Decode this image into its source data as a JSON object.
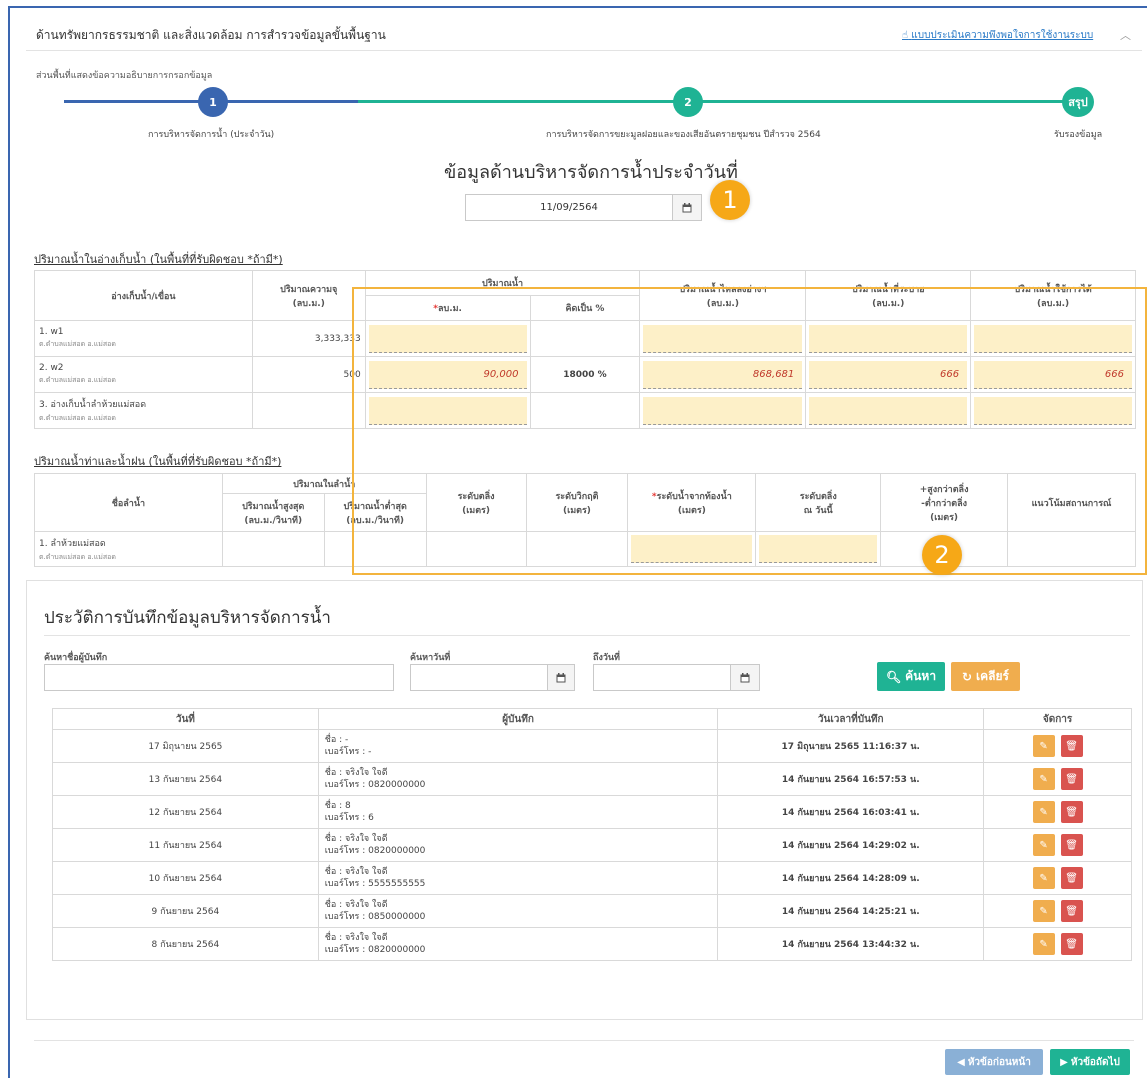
{
  "header": {
    "title": "ด้านทรัพยากรธรรมชาติ และสิ่งแวดล้อม การสำรวจข้อมูลขั้นพื้นฐาน",
    "survey_link": "แบบประเมินความพึงพอใจการใช้งานระบบ",
    "note": "ส่วนพื้นที่แสดงข้อความอธิบายการกรอกข้อมูล"
  },
  "steps": [
    {
      "number": "1",
      "label": "การบริหารจัดการน้ำ (ประจำวัน)"
    },
    {
      "number": "2",
      "label": "การบริหารจัดการขยะมูลฝอยและของเสียอันตรายชุมชน ปีสำรวจ 2564"
    },
    {
      "number": "สรุป",
      "label": "รับรองข้อมูล"
    }
  ],
  "main_title": "ข้อมูลด้านบริหารจัดการน้ำประจำวันที่",
  "date_value": "11/09/2564",
  "callouts": [
    "1",
    "2"
  ],
  "reservoir": {
    "title": "ปริมาณน้ำในอ่างเก็บน้ำ (ในพื้นที่ที่รับผิดชอบ *ถ้ามี*)",
    "headers": {
      "name": "อ่างเก็บน้ำ/เขื่อน",
      "capacity": "ปริมาณความจุ",
      "capacity_unit": "(ลบ.ม.)",
      "water": "ปริมาณน้ำ",
      "water_m3": "ลบ.ม.",
      "water_pct": "คิดเป็น %",
      "inflow": "ปริมาณน้ำไหลลงอ่างฯ",
      "inflow_unit": "(ลบ.ม.)",
      "release": "ปริมาณน้ำที่ระบาย",
      "release_unit": "(ลบ.ม.)",
      "usable": "ปริมาณน้ำใช้การได้",
      "usable_unit": "(ลบ.ม.)"
    },
    "rows": [
      {
        "name": "1. w1",
        "sub": "ต.ตำบลแม่สอด อ.แม่สอด",
        "capacity": "3,333,333",
        "water": "",
        "pct": "",
        "inflow": "",
        "release": "",
        "usable": ""
      },
      {
        "name": "2. w2",
        "sub": "ต.ตำบลแม่สอด อ.แม่สอด",
        "capacity": "500",
        "water": "90,000",
        "pct": "18000 %",
        "inflow": "868,681",
        "release": "666",
        "usable": "666"
      },
      {
        "name": "3. อ่างเก็บน้ำลำห้วยแม่สอด",
        "sub": "ต.ตำบลแม่สอด อ.แม่สอด",
        "capacity": "",
        "water": "",
        "pct": "",
        "inflow": "",
        "release": "",
        "usable": ""
      }
    ]
  },
  "river": {
    "title": "ปริมาณน้ำท่าและน้ำฝน (ในพื้นที่ที่รับผิดชอบ *ถ้ามี*)",
    "headers": {
      "name": "ชื่อลำน้ำ",
      "flow": "ปริมาณในลำน้ำ",
      "max_l1": "ปริมาณน้ำสูงสุด",
      "max_l2": "(ลบ.ม./วินาที)",
      "min_l1": "ปริมาณน้ำต่ำสุด",
      "min_l2": "(ลบ.ม./วินาที)",
      "bank_l1": "ระดับตลิ่ง",
      "bank_l2": "(เมตร)",
      "crit_l1": "ระดับวิกฤติ",
      "crit_l2": "(เมตร)",
      "level_l1": "ระดับน้ำจากท้องน้ำ",
      "level_l2": "(เมตร)",
      "today_l1": "ระดับตลิ่ง",
      "today_l2": "ณ วันนี้",
      "diff_l1": "+สูงกว่าตลิ่ง",
      "diff_l2": "-ต่ำกว่าตลิ่ง",
      "diff_l3": "(เมตร)",
      "trend": "แนวโน้มสถานการณ์"
    },
    "rows": [
      {
        "name": "1. ลำห้วยแม่สอด",
        "sub": "ต.ตำบลแม่สอด อ.แม่สอด"
      }
    ]
  },
  "history": {
    "title": "ประวัติการบันทึกข้อมูลบริหารจัดการน้ำ",
    "search_name_label": "ค้นหาชื่อผู้บันทึก",
    "search_date_label": "ค้นหาวันที่",
    "to_date_label": "ถึงวันที่",
    "search_btn": "ค้นหา",
    "clear_btn": "เคลียร์",
    "columns": [
      "วันที่",
      "ผู้บันทึก",
      "วันเวลาที่บันทึก",
      "จัดการ"
    ],
    "rows": [
      {
        "date": "17 มิถุนายน 2565",
        "name": "ชื่อ : -",
        "phone": "เบอร์โทร : -",
        "saved": "17 มิถุนายน 2565 11:16:37 น."
      },
      {
        "date": "13 กันยายน 2564",
        "name": "ชื่อ : จริงใจ ใจดี",
        "phone": "เบอร์โทร : 0820000000",
        "saved": "14 กันยายน 2564 16:57:53 น."
      },
      {
        "date": "12 กันยายน 2564",
        "name": "ชื่อ : 8",
        "phone": "เบอร์โทร : 6",
        "saved": "14 กันยายน 2564 16:03:41 น."
      },
      {
        "date": "11 กันยายน 2564",
        "name": "ชื่อ : จริงใจ ใจดี",
        "phone": "เบอร์โทร : 0820000000",
        "saved": "14 กันยายน 2564 14:29:02 น."
      },
      {
        "date": "10 กันยายน 2564",
        "name": "ชื่อ : จริงใจ ใจดี",
        "phone": "เบอร์โทร : 5555555555",
        "saved": "14 กันยายน 2564 14:28:09 น."
      },
      {
        "date": "9 กันยายน 2564",
        "name": "ชื่อ : จริงใจ ใจดี",
        "phone": "เบอร์โทร : 0850000000",
        "saved": "14 กันยายน 2564 14:25:21 น."
      },
      {
        "date": "8 กันยายน 2564",
        "name": "ชื่อ : จริงใจ ใจดี",
        "phone": "เบอร์โทร : 0820000000",
        "saved": "14 กันยายน 2564 13:44:32 น."
      }
    ]
  },
  "footer": {
    "prev_btn": "หัวข้อก่อนหน้า",
    "next_btn": "หัวข้อถัดไป"
  },
  "colors": {
    "step_blue": "#3a66b0",
    "step_green": "#1fb394",
    "callout": "#f6a817",
    "edit_orange": "#f0ad4e",
    "delete_red": "#d9534f"
  },
  "icons": [
    "thumbs-up-icon",
    "chevron-up-icon",
    "calendar-icon",
    "search-icon",
    "refresh-icon",
    "edit-icon",
    "trash-icon",
    "arrow-left-icon",
    "arrow-right-icon"
  ]
}
